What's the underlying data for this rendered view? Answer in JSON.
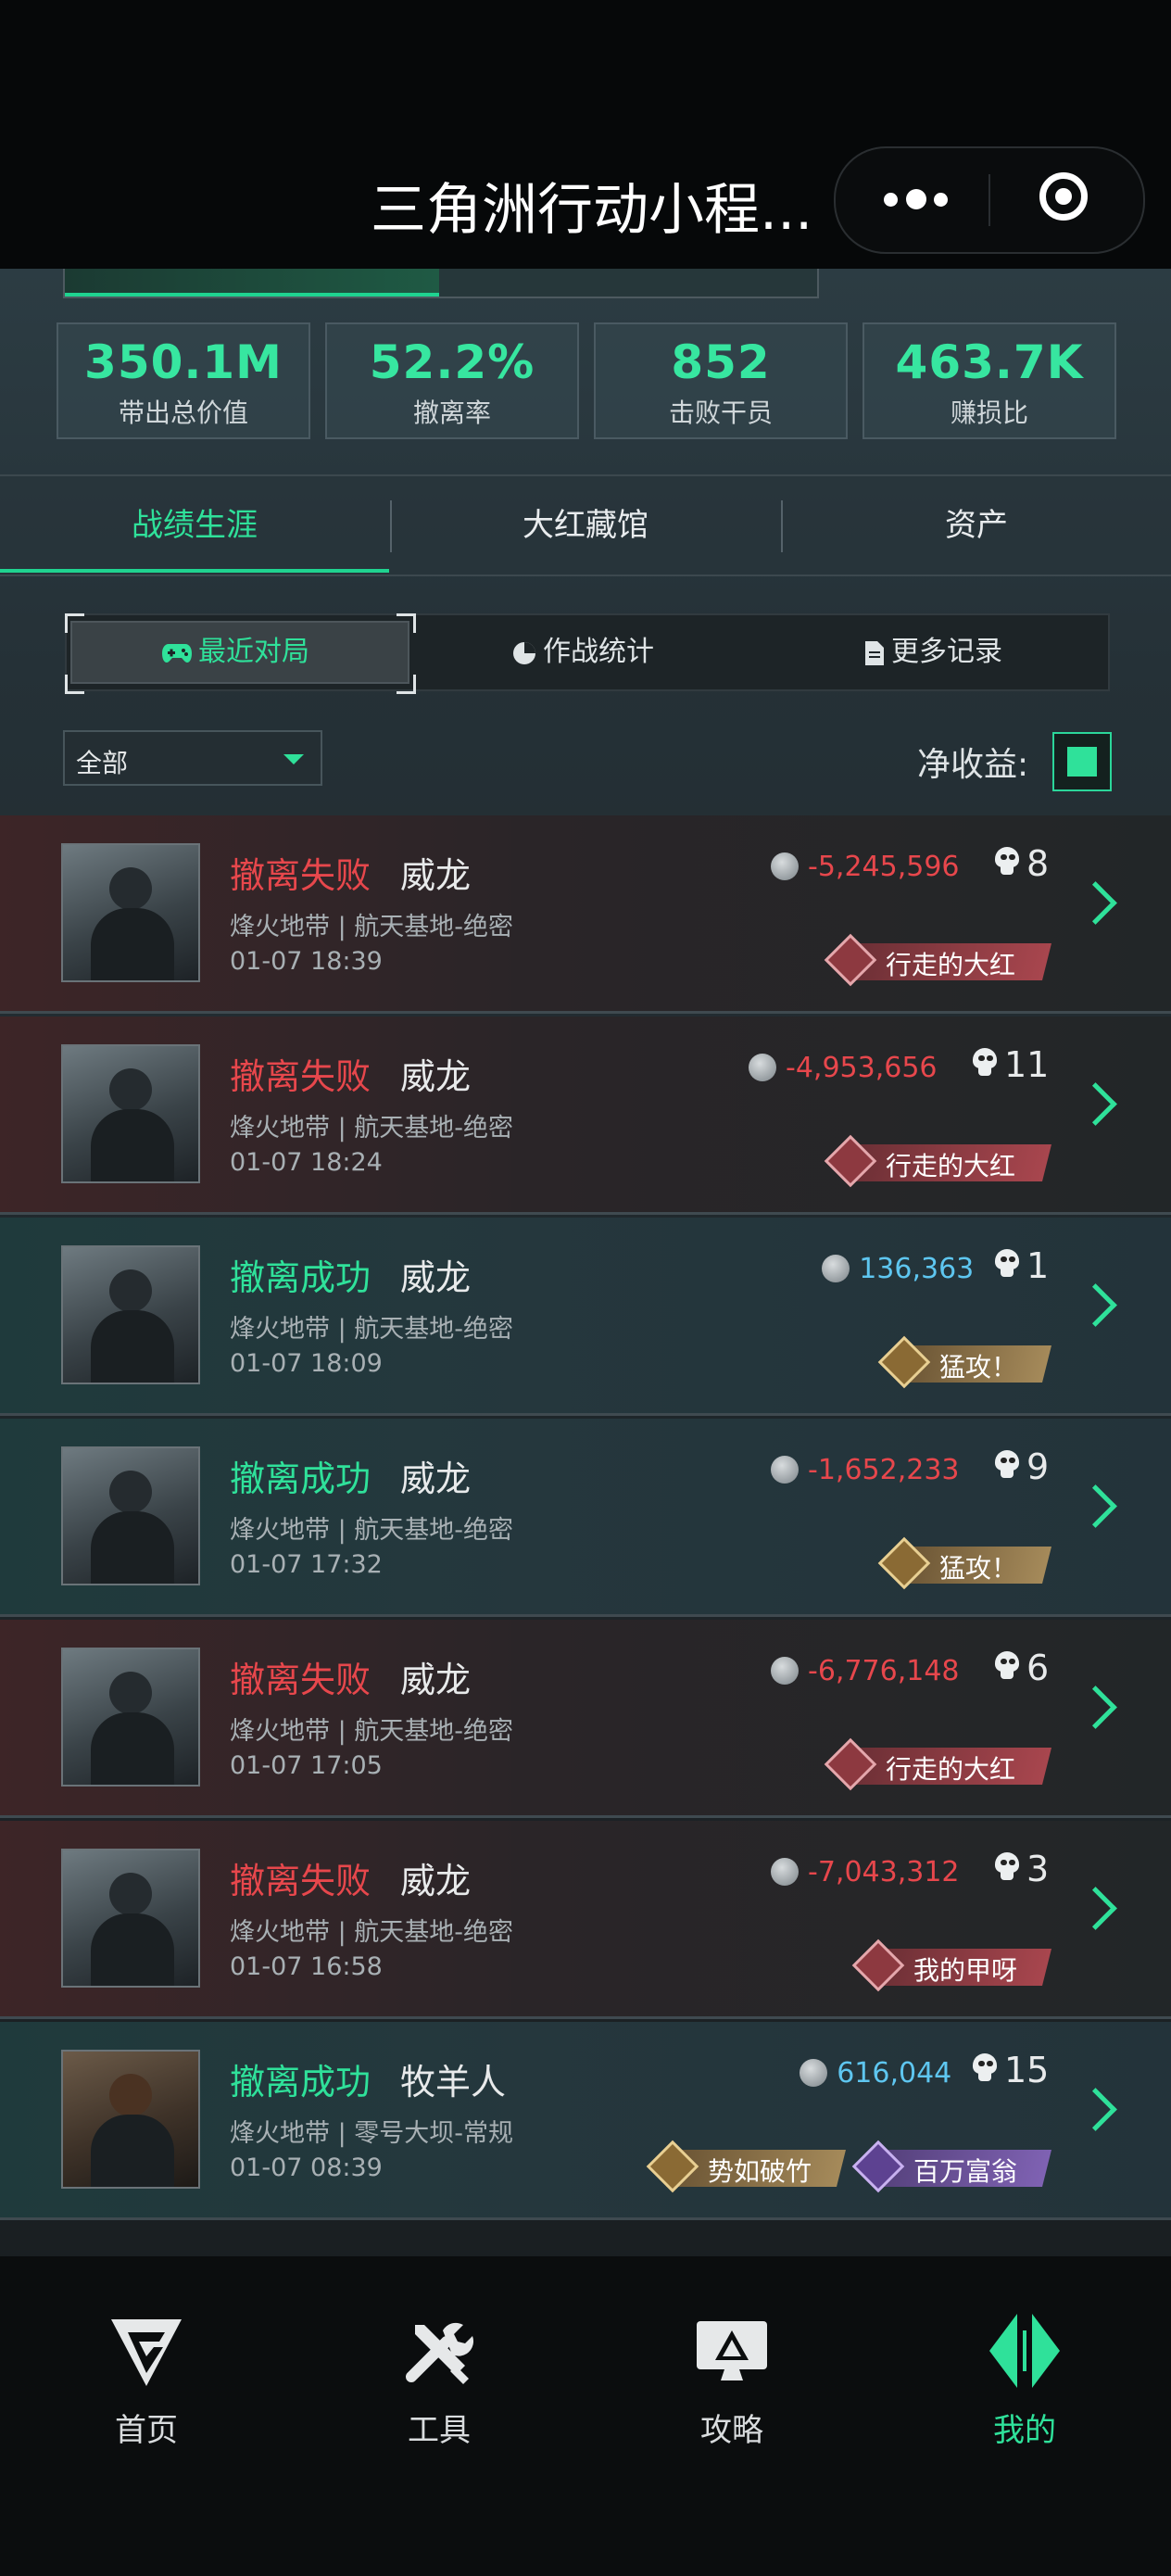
{
  "header": {
    "title": "三角洲行动小程...",
    "more_icon": "more-dots-icon",
    "close_icon": "target-circle-icon"
  },
  "stats": [
    {
      "value": "350.1M",
      "label": "带出总价值"
    },
    {
      "value": "52.2%",
      "label": "撤离率"
    },
    {
      "value": "852",
      "label": "击败干员"
    },
    {
      "value": "463.7K",
      "label": "赚损比"
    }
  ],
  "main_tabs": [
    {
      "label": "战绩生涯",
      "active": true
    },
    {
      "label": "大红藏馆",
      "active": false
    },
    {
      "label": "资产",
      "active": false
    }
  ],
  "sub_tabs": [
    {
      "label": "最近对局",
      "icon": "gamepad-icon",
      "active": true
    },
    {
      "label": "作战统计",
      "icon": "pie-chart-icon",
      "active": false
    },
    {
      "label": "更多记录",
      "icon": "document-icon",
      "active": false
    }
  ],
  "filter": {
    "selected": "全部"
  },
  "net_income": {
    "label": "净收益:",
    "checked": true
  },
  "matches": [
    {
      "result": "撤离失败",
      "status": "fail",
      "operator": "威龙",
      "map": "烽火地带 | 航天基地-绝密",
      "time": "01-07 18:39",
      "value": "-5,245,596",
      "kills": "8",
      "badges": [
        {
          "text": "行走的大红",
          "style": "red"
        }
      ]
    },
    {
      "result": "撤离失败",
      "status": "fail",
      "operator": "威龙",
      "map": "烽火地带 | 航天基地-绝密",
      "time": "01-07 18:24",
      "value": "-4,953,656",
      "kills": "11",
      "badges": [
        {
          "text": "行走的大红",
          "style": "red"
        }
      ]
    },
    {
      "result": "撤离成功",
      "status": "success",
      "operator": "威龙",
      "map": "烽火地带 | 航天基地-绝密",
      "time": "01-07 18:09",
      "value": "136,363",
      "kills": "1",
      "badges": [
        {
          "text": "猛攻！",
          "style": "gold"
        }
      ]
    },
    {
      "result": "撤离成功",
      "status": "success",
      "operator": "威龙",
      "map": "烽火地带 | 航天基地-绝密",
      "time": "01-07 17:32",
      "value": "-1,652,233",
      "kills": "9",
      "badges": [
        {
          "text": "猛攻！",
          "style": "gold"
        }
      ]
    },
    {
      "result": "撤离失败",
      "status": "fail",
      "operator": "威龙",
      "map": "烽火地带 | 航天基地-绝密",
      "time": "01-07 17:05",
      "value": "-6,776,148",
      "kills": "6",
      "badges": [
        {
          "text": "行走的大红",
          "style": "red"
        }
      ]
    },
    {
      "result": "撤离失败",
      "status": "fail",
      "operator": "威龙",
      "map": "烽火地带 | 航天基地-绝密",
      "time": "01-07 16:58",
      "value": "-7,043,312",
      "kills": "3",
      "badges": [
        {
          "text": "我的甲呀",
          "style": "red"
        }
      ]
    },
    {
      "result": "撤离成功",
      "status": "success",
      "operator": "牧羊人",
      "map": "烽火地带 | 零号大坝-常规",
      "time": "01-07 08:39",
      "value": "616,044",
      "kills": "15",
      "badges": [
        {
          "text": "势如破竹",
          "style": "gold"
        },
        {
          "text": "百万富翁",
          "style": "purple"
        }
      ]
    }
  ],
  "bottom_nav": [
    {
      "label": "首页",
      "icon": "home-logo-icon",
      "active": false
    },
    {
      "label": "工具",
      "icon": "tools-icon",
      "active": false
    },
    {
      "label": "攻略",
      "icon": "guide-monitor-icon",
      "active": false
    },
    {
      "label": "我的",
      "icon": "profile-logo-icon",
      "active": true
    }
  ],
  "colors": {
    "accent": "#2fe19a",
    "fail": "#e7474c",
    "positive_value": "#5ec6f0"
  }
}
